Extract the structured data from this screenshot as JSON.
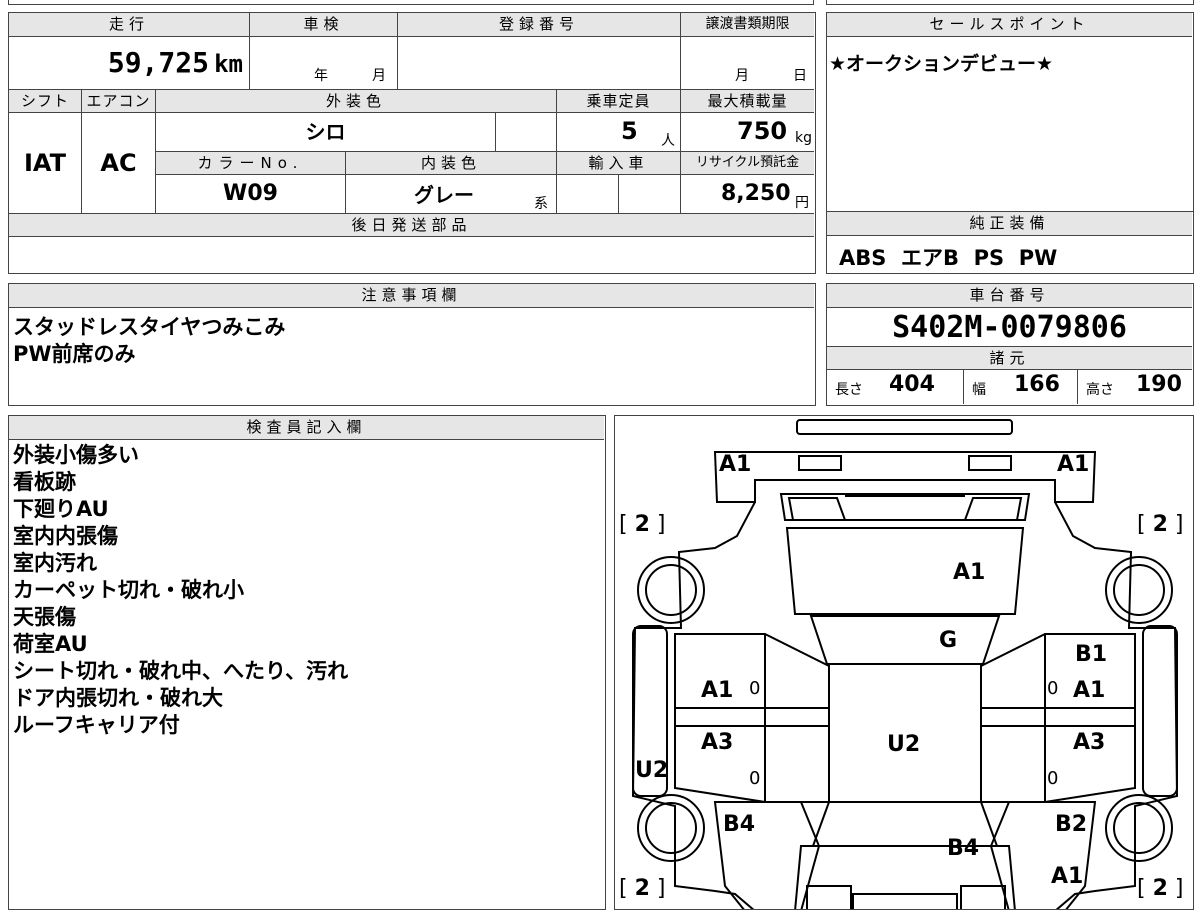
{
  "mileage": {
    "header": "走行",
    "value": "59,725",
    "unit": "km"
  },
  "inspection": {
    "header": "車検",
    "year_unit": "年",
    "month_unit": "月"
  },
  "registration": {
    "header": "登録番号"
  },
  "transfer": {
    "header": "譲渡書類期限",
    "month_unit": "月",
    "day_unit": "日"
  },
  "sales_point": {
    "header": "セールスポイント",
    "text": "★オークションデビュー★"
  },
  "shift": {
    "header": "シフト",
    "value": "IAT"
  },
  "aircon": {
    "header": "エアコン",
    "value": "AC"
  },
  "exterior_color": {
    "header": "外装色",
    "value": "シロ"
  },
  "capacity": {
    "header": "乗車定員",
    "value": "5",
    "unit": "人"
  },
  "max_load": {
    "header": "最大積載量",
    "value": "750",
    "unit": "kg"
  },
  "color_no": {
    "header": "カラーNo.",
    "value": "W09"
  },
  "interior_color": {
    "header": "内装色",
    "value": "グレー",
    "suffix": "系"
  },
  "import": {
    "header": "輸入車"
  },
  "recycle": {
    "header": "リサイクル預託金",
    "value": "8,250",
    "unit": "円"
  },
  "later_parts": {
    "header": "後日発送部品"
  },
  "equipment": {
    "header": "純正装備",
    "value": "ABS  エアB  PS  PW"
  },
  "notes": {
    "header": "注意事項欄",
    "lines": [
      "スタッドレスタイヤつみこみ",
      "PW前席のみ"
    ]
  },
  "chassis": {
    "header": "車台番号",
    "value": "S402M-0079806"
  },
  "specs": {
    "header": "諸元",
    "length_label": "長さ",
    "length": "404",
    "width_label": "幅",
    "width": "166",
    "height_label": "高さ",
    "height": "190"
  },
  "inspector": {
    "header": "検査員記入欄",
    "lines": [
      "外装小傷多い",
      "看板跡",
      "下廻りAU",
      "室内内張傷",
      "室内汚れ",
      "カーペット切れ・破れ小",
      "天張傷",
      "荷室AU",
      "シート切れ・破れ中、へたり、汚れ",
      "ドア内張切れ・破れ大",
      "ルーフキャリア付"
    ]
  },
  "diagram": {
    "front_left": "A1",
    "front_right": "A1",
    "hood": "A1",
    "windshield": "G",
    "left_front_door": "A1",
    "left_rear_door": "A3",
    "right_front_top": "B1",
    "right_front_door": "A1",
    "right_rear_door": "A3",
    "roof": "U2",
    "left_rocker": "U2",
    "left_rear_quarter": "B4",
    "rear": "B4",
    "right_rear_quarter": "B2",
    "rear_right": "A1",
    "tire_fl": "2",
    "tire_fr": "2",
    "tire_rl": "2",
    "tire_rr": "2",
    "zero": "0"
  }
}
